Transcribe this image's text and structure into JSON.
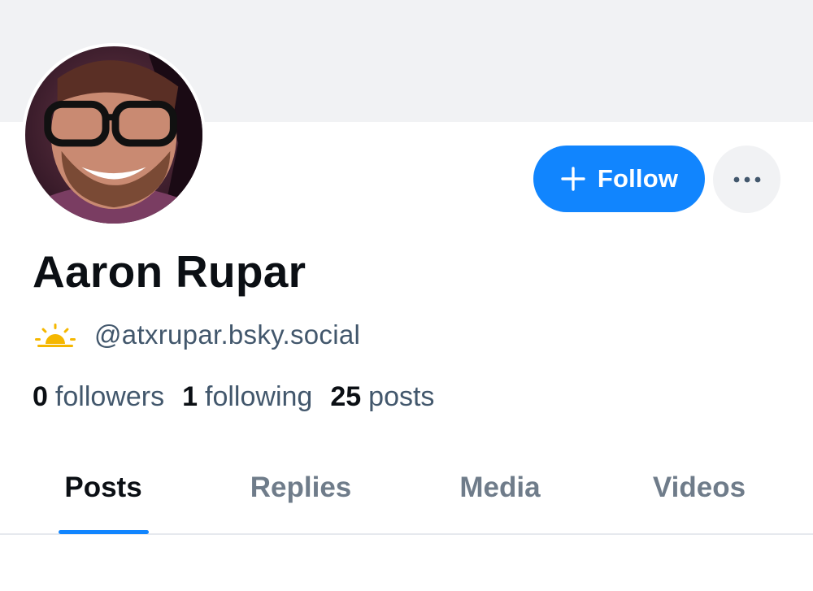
{
  "profile": {
    "display_name": "Aaron Rupar",
    "handle": "@atxrupar.bsky.social",
    "handle_icon": "sunrise-icon"
  },
  "actions": {
    "follow_label": "Follow",
    "follow_icon": "plus-icon",
    "more_icon": "ellipsis-icon"
  },
  "stats": [
    {
      "value": "0",
      "label": "followers"
    },
    {
      "value": "1",
      "label": "following"
    },
    {
      "value": "25",
      "label": "posts"
    }
  ],
  "tabs": [
    {
      "label": "Posts",
      "active": true
    },
    {
      "label": "Replies",
      "active": false
    },
    {
      "label": "Media",
      "active": false
    },
    {
      "label": "Videos",
      "active": false
    }
  ],
  "colors": {
    "accent": "#1185fe",
    "banner": "#f1f2f4",
    "text_primary": "#0b0f14",
    "text_secondary": "#42576c",
    "tab_inactive": "#6f7c8a",
    "sun": "#f5b700"
  }
}
